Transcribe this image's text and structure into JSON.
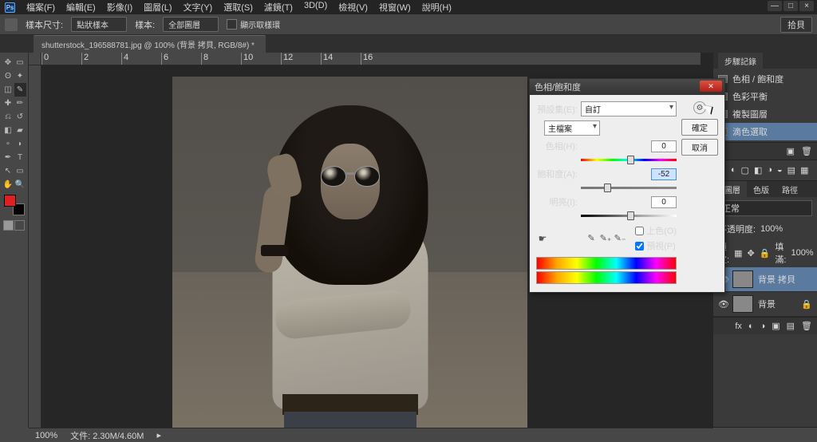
{
  "app": {
    "logo_text": "Ps"
  },
  "menu": [
    "檔案(F)",
    "編輯(E)",
    "影像(I)",
    "圖層(L)",
    "文字(Y)",
    "選取(S)",
    "濾鏡(T)",
    "3D(D)",
    "檢視(V)",
    "視窗(W)",
    "說明(H)"
  ],
  "window_controls": {
    "min": "—",
    "max": "□",
    "close": "×"
  },
  "options_bar": {
    "label_size": "樣本尺寸:",
    "size_value": "點狀樣本",
    "label_sample": "樣本:",
    "sample_value": "全部圖層",
    "checkbox": "顯示取樣環",
    "right_btn": "拾貝"
  },
  "tab": {
    "title": "shutterstock_196588781.jpg @ 100% (背景 拷貝, RGB/8#) *"
  },
  "ruler_marks": [
    "0",
    "2",
    "4",
    "6",
    "8",
    "10",
    "12",
    "14",
    "16"
  ],
  "panels": {
    "history": {
      "tab": "步驟記錄",
      "items": [
        "色相 / 飽和度",
        "色彩平衡",
        "複製圖層",
        "滴色選取"
      ]
    },
    "adjust_icons": [
      "☀",
      "◐",
      "▢",
      "◧",
      "◑",
      "◒",
      "▤",
      "▦"
    ],
    "layers": {
      "tabs": [
        "圖層",
        "色版",
        "路徑"
      ],
      "mode_label": "正常",
      "opacity_label": "不透明度:",
      "opacity_value": "100%",
      "lock_label": "鎖定:",
      "fill_label": "填滿:",
      "fill_value": "100%",
      "items": [
        {
          "name": "背景 拷貝"
        },
        {
          "name": "背景",
          "locked": true
        }
      ]
    }
  },
  "dialog": {
    "title": "色相/飽和度",
    "preset_label": "預設集(E):",
    "preset_value": "自訂",
    "channel_label": "主檔案",
    "hue_label": "色相(H):",
    "hue_value": "0",
    "sat_label": "飽和度(A):",
    "sat_value": "-52",
    "lig_label": "明亮(I):",
    "lig_value": "0",
    "colorize": "上色(O)",
    "preview": "預視(P)",
    "ok": "確定",
    "cancel": "取消"
  },
  "status": {
    "zoom": "100%",
    "doc": "文件: 2.30M/4.60M"
  }
}
